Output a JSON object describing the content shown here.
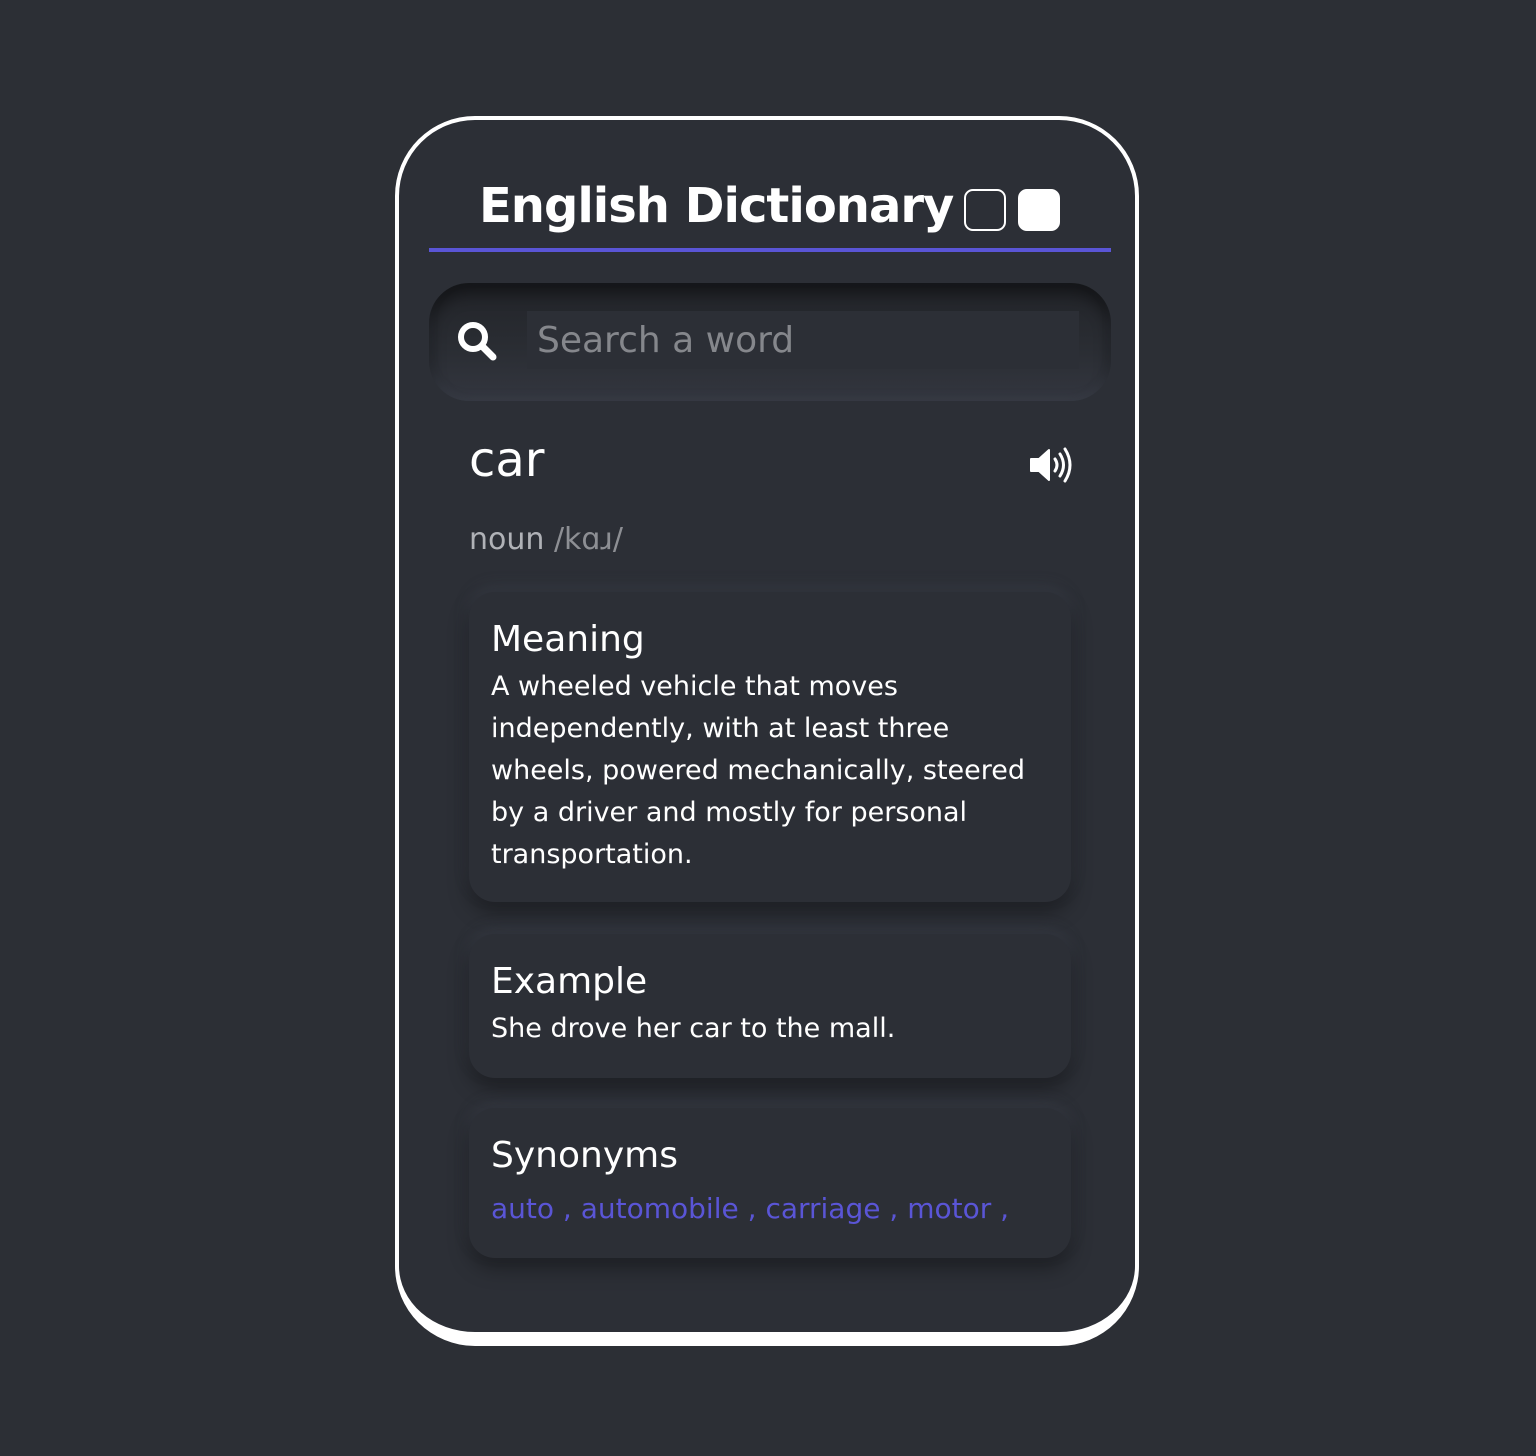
{
  "app": {
    "title": "English Dictionary"
  },
  "theme": {
    "dark_toggle": "dark",
    "light_toggle": "light",
    "accent_color": "#5a55d6"
  },
  "search": {
    "placeholder": "Search a word",
    "value": "",
    "icon": "search-icon"
  },
  "result": {
    "word": "car",
    "part_of_speech": "noun",
    "phonetic": "/kɑɹ/",
    "audio_icon": "speaker-icon",
    "sections": {
      "meaning": {
        "heading": "Meaning",
        "text": "A wheeled vehicle that moves independently, with at least three wheels, powered mechanically, steered by a driver and mostly for personal transportation."
      },
      "example": {
        "heading": "Example",
        "text": "She drove her car to the mall."
      },
      "synonyms": {
        "heading": "Synonyms",
        "items": [
          "auto",
          "automobile",
          "carriage",
          "motor"
        ],
        "separator": ","
      }
    }
  }
}
